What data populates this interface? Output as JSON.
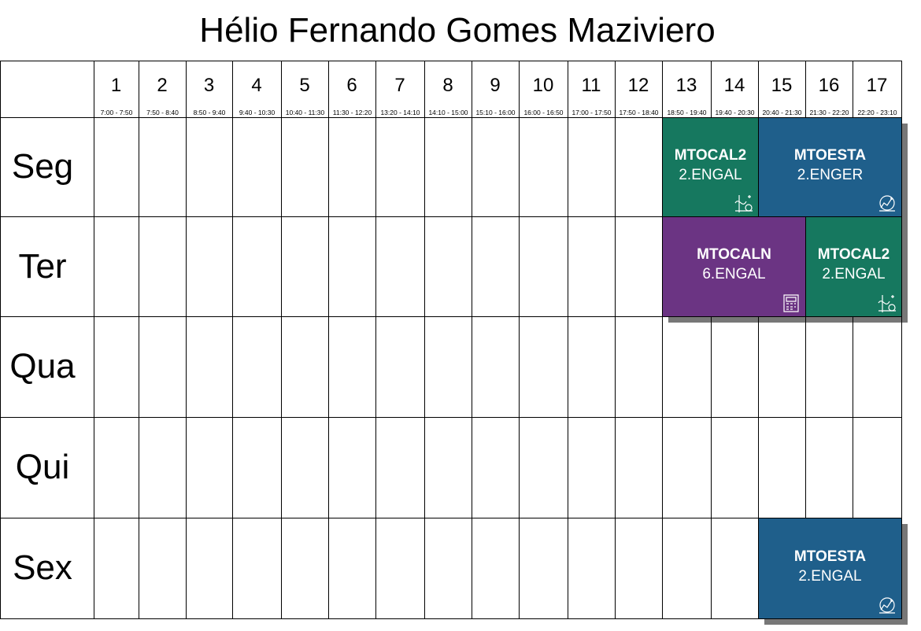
{
  "title": "Hélio Fernando Gomes Maziviero",
  "periods": [
    {
      "num": "1",
      "time": "7:00 - 7:50"
    },
    {
      "num": "2",
      "time": "7:50 - 8:40"
    },
    {
      "num": "3",
      "time": "8:50 - 9:40"
    },
    {
      "num": "4",
      "time": "9:40 - 10:30"
    },
    {
      "num": "5",
      "time": "10:40 - 11:30"
    },
    {
      "num": "6",
      "time": "11:30 - 12:20"
    },
    {
      "num": "7",
      "time": "13:20 - 14:10"
    },
    {
      "num": "8",
      "time": "14:10 - 15:00"
    },
    {
      "num": "9",
      "time": "15:10 - 16:00"
    },
    {
      "num": "10",
      "time": "16:00 - 16:50"
    },
    {
      "num": "11",
      "time": "17:00 - 17:50"
    },
    {
      "num": "12",
      "time": "17:50 - 18:40"
    },
    {
      "num": "13",
      "time": "18:50 - 19:40"
    },
    {
      "num": "14",
      "time": "19:40 - 20:30"
    },
    {
      "num": "15",
      "time": "20:40 - 21:30"
    },
    {
      "num": "16",
      "time": "21:30 - 22:20"
    },
    {
      "num": "17",
      "time": "22:20 - 23:10"
    }
  ],
  "days": [
    "Seg",
    "Ter",
    "Qua",
    "Qui",
    "Sex"
  ],
  "classes": [
    {
      "day": 0,
      "start": 13,
      "end": 14,
      "code": "MTOCAL2",
      "group": "2.ENGAL",
      "color": "#16785f",
      "icon": "math-icon"
    },
    {
      "day": 0,
      "start": 15,
      "end": 17,
      "code": "MTOESTA",
      "group": "2.ENGER",
      "color": "#1f5f8b",
      "icon": "stats-icon"
    },
    {
      "day": 1,
      "start": 13,
      "end": 15,
      "code": "MTOCALN",
      "group": "6.ENGAL",
      "color": "#6b3483",
      "icon": "calculator-icon"
    },
    {
      "day": 1,
      "start": 16,
      "end": 17,
      "code": "MTOCAL2",
      "group": "2.ENGAL",
      "color": "#16785f",
      "icon": "math-icon"
    },
    {
      "day": 4,
      "start": 15,
      "end": 17,
      "code": "MTOESTA",
      "group": "2.ENGAL",
      "color": "#1f5f8b",
      "icon": "stats-icon"
    }
  ]
}
